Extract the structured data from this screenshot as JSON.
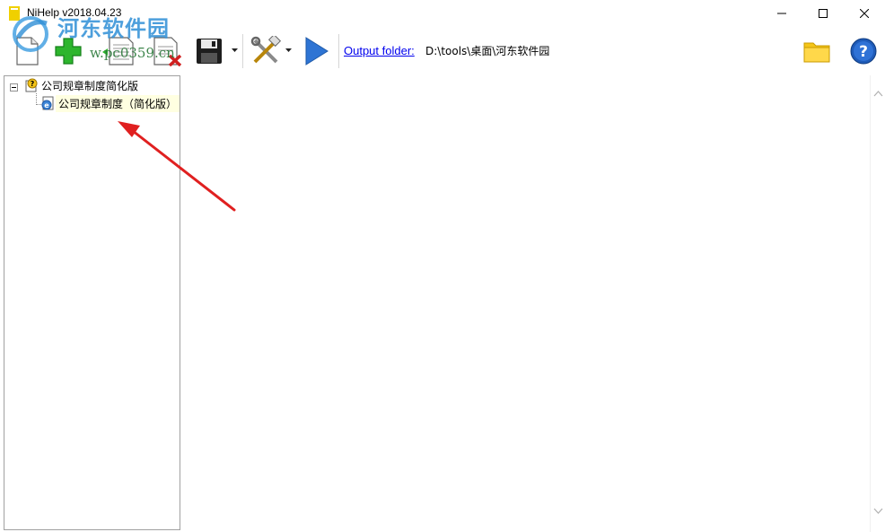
{
  "window": {
    "title": "NiHelp v2018.04.23"
  },
  "watermark": {
    "site_name": "河东软件园",
    "url": "w.pc0359.cn"
  },
  "toolbar": {
    "buttons": [
      {
        "name": "new-project-button",
        "icon": "new-document-icon"
      },
      {
        "name": "add-topic-button",
        "icon": "green-plus-icon"
      },
      {
        "name": "edit-topic-button",
        "icon": "document-edit-icon"
      },
      {
        "name": "delete-topic-button",
        "icon": "document-delete-icon"
      },
      {
        "name": "save-button",
        "icon": "floppy-disk-icon"
      },
      {
        "name": "tools-button",
        "icon": "tools-icon"
      },
      {
        "name": "compile-button",
        "icon": "play-icon"
      },
      {
        "name": "browse-folder-button",
        "icon": "folder-icon"
      },
      {
        "name": "help-button",
        "icon": "help-icon"
      }
    ],
    "output_label": "Output folder:",
    "output_path": "D:\\tools\\桌面\\河东软件园"
  },
  "tree": {
    "root_label": "公司规章制度简化版",
    "child_label": "公司规章制度（简化版）"
  },
  "colors": {
    "link": "#0000ee",
    "selected_bg": "#ffffe1",
    "arrow": "#e02020",
    "play_blue": "#2e74d4",
    "plus_green": "#2db52d"
  }
}
